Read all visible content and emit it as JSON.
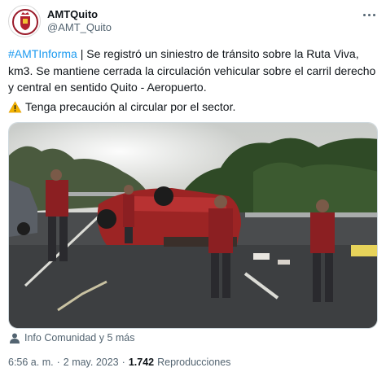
{
  "author": {
    "display_name": "AMTQuito",
    "handle": "@AMT_Quito",
    "avatar_icon": "amt-quito-crest-icon"
  },
  "tweet": {
    "hashtag": "#AMTInforma",
    "line1_rest": " | Se registró un siniestro de tránsito sobre la Ruta Viva,",
    "line2": "km3. Se mantiene cerrada la circulación vehicular sobre el carril derecho",
    "line3": "y central en sentido Quito - Aeropuerto.",
    "warning_text": "Tenga precaución al circular por el sector.",
    "warning_icon": "warning-sign-icon"
  },
  "media": {
    "image_icon": "overturned-car-accident-photo"
  },
  "tagged": {
    "icon": "person-icon",
    "label": "Info Comunidad y 5 más"
  },
  "meta": {
    "time": "6:56 a. m.",
    "separator": "·",
    "date": "2 may. 2023",
    "views_count": "1.742",
    "views_label": "Reproducciones"
  },
  "colors": {
    "link": "#1d9bf0",
    "text": "#0f1419",
    "secondary": "#536471"
  }
}
